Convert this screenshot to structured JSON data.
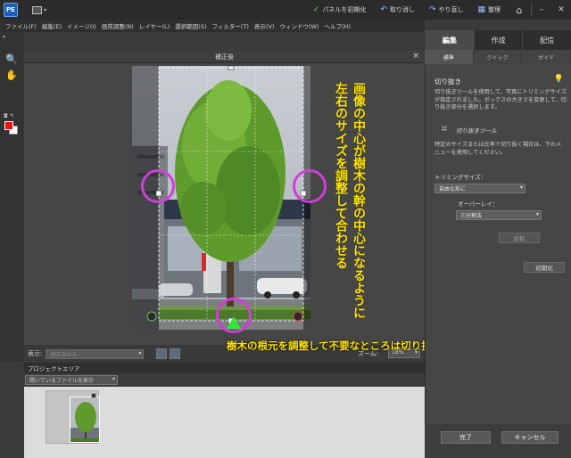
{
  "titlebar": {
    "logo_text": "PE",
    "reset_panels": "パネルを初期化",
    "undo": "取り消し",
    "redo": "やり直し",
    "organize": "整理"
  },
  "menu": [
    "ファイル(F)",
    "編集(E)",
    "イメージ(I)",
    "画質調整(N)",
    "レイヤー(L)",
    "選択範囲(S)",
    "フィルター(T)",
    "表示(V)",
    "ウィンドウ(W)",
    "ヘルプ(H)"
  ],
  "panel_tabs": [
    "編集",
    "作成",
    "配信"
  ],
  "panel_subtabs": [
    "標準",
    "クイック",
    "ガイド"
  ],
  "document": {
    "title": "補正後",
    "close_glyph": "×"
  },
  "status": {
    "view_label": "表示:",
    "view_select": "補正前のみ",
    "zoom_label": "ズーム:",
    "zoom_value": "18%"
  },
  "project": {
    "title": "プロジェクトエリア",
    "select": "開いているファイルを表示"
  },
  "crop_panel": {
    "title": "切り抜き",
    "description": "切り抜きツールを使用して、写真にトリミングサイズが指定されました。ボックスの大きさを変更して、切り抜き部分を選択します。",
    "tool_name": "切り抜きツール",
    "description2": "特定のサイズまたは比率で切り抜く場合は、下のメニューを使用してください。",
    "trim_size_label": "トリミングサイズ：",
    "trim_size_value": "自由な形に",
    "overlay_label": "オーバーレイ：",
    "overlay_value": "三分割法",
    "rotate_button": "反転",
    "reset_button": "初期化",
    "done_button": "完了",
    "cancel_button": "キャンセル"
  },
  "annotations": {
    "vertical_right": "画像の中心が樹木の幹の中心になるように",
    "vertical_left": "左右のサイズを調整して合わせる",
    "bottom": "樹木の根元を調整して不要なところは切り抜くよう設定する"
  },
  "colors": {
    "annotation_text": "#ffe400",
    "annotation_circle": "#d03dd8",
    "marker": "#2ee83a",
    "foreground_swatch": "#e11111"
  }
}
